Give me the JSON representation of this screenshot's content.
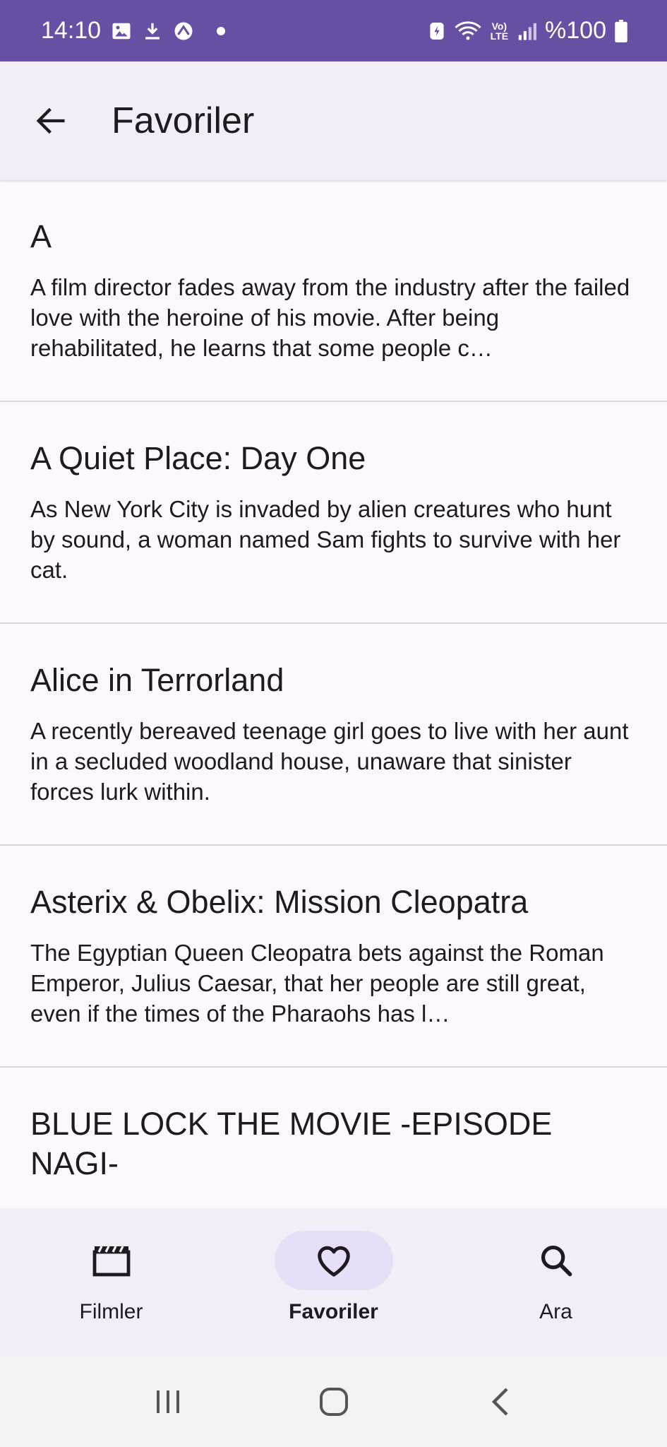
{
  "status_bar": {
    "time": "14:10",
    "battery": "%100",
    "lte_label_top": "Vo)",
    "lte_label_bottom": "LTE"
  },
  "app_bar": {
    "title": "Favoriler"
  },
  "movies": [
    {
      "title": "A",
      "overview": "A film director fades away from the industry after the failed love with the heroine of his movie. After being rehabilitated, he learns that some people c…"
    },
    {
      "title": "A Quiet Place: Day One",
      "overview": "As New York City is invaded by alien creatures who hunt by sound, a woman named Sam fights to survive with her cat."
    },
    {
      "title": "Alice in Terrorland",
      "overview": "A recently bereaved teenage girl goes to live with her aunt in a secluded woodland house, unaware that sinister forces lurk within."
    },
    {
      "title": "Asterix & Obelix: Mission Cleopatra",
      "overview": "The Egyptian Queen Cleopatra bets against the Roman Emperor, Julius Caesar, that her people are still great, even if the times of the Pharaohs has l…"
    },
    {
      "title": "BLUE LOCK THE MOVIE -EPISODE NAGI-",
      "overview": ""
    }
  ],
  "bottom_nav": {
    "items": [
      {
        "label": "Filmler",
        "icon": "clapperboard-icon",
        "active": false
      },
      {
        "label": "Favoriler",
        "icon": "heart-icon",
        "active": true
      },
      {
        "label": "Ara",
        "icon": "search-icon",
        "active": false
      }
    ]
  },
  "colors": {
    "status_bar": "#6750a4",
    "surface": "#fdf7ff",
    "app_bar": "#f3edf7",
    "nav_indicator": "#e8def8",
    "divider": "#d9d4dc"
  }
}
